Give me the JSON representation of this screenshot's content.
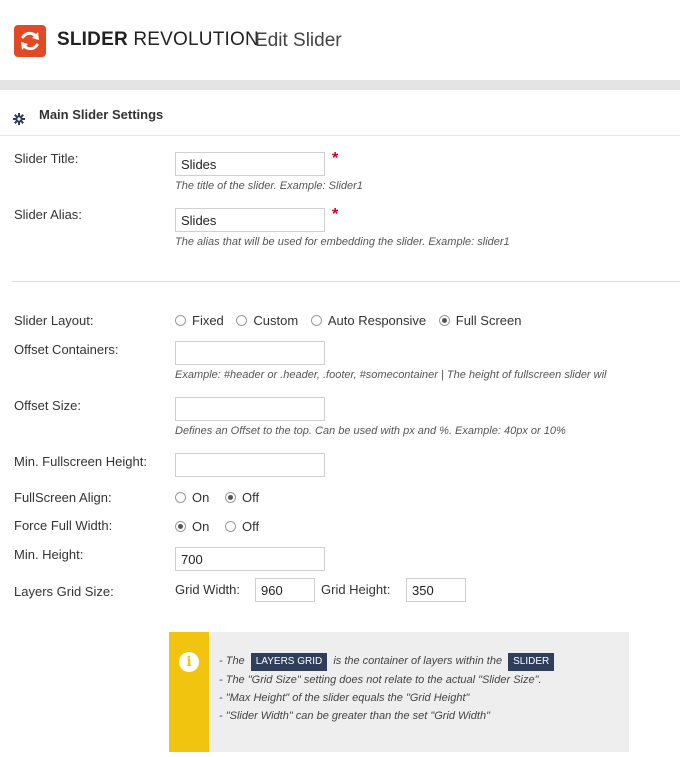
{
  "header": {
    "brand_bold": "SLIDER",
    "brand_light": "REVOLUTION",
    "page_title": "Edit Slider",
    "logo_color": "#e14a24"
  },
  "section": {
    "title": "Main Slider Settings",
    "icon": "gear-icon"
  },
  "fields": {
    "slider_title": {
      "label": "Slider Title:",
      "value": "Slides",
      "required": "*",
      "desc": "The title of the slider. Example: Slider1"
    },
    "slider_alias": {
      "label": "Slider Alias:",
      "value": "Slides",
      "required": "*",
      "desc": "The alias that will be used for embedding the slider. Example: slider1"
    },
    "slider_layout": {
      "label": "Slider Layout:",
      "options": [
        "Fixed",
        "Custom",
        "Auto Responsive",
        "Full Screen"
      ],
      "selected": "Full Screen"
    },
    "offset_containers": {
      "label": "Offset Containers:",
      "value": "",
      "desc": "Example: #header or .header, .footer, #somecontainer | The height of fullscreen slider wil"
    },
    "offset_size": {
      "label": "Offset Size:",
      "value": "",
      "desc": "Defines an Offset to the top. Can be used with px and %. Example: 40px or 10%"
    },
    "min_fullscreen_height": {
      "label": "Min. Fullscreen Height:",
      "value": ""
    },
    "fullscreen_align": {
      "label": "FullScreen Align:",
      "options": [
        "On",
        "Off"
      ],
      "selected": "Off"
    },
    "force_full_width": {
      "label": "Force Full Width:",
      "options": [
        "On",
        "Off"
      ],
      "selected": "On"
    },
    "min_height": {
      "label": "Min. Height:",
      "value": "700"
    },
    "layers_grid_size": {
      "label": "Layers Grid Size:",
      "grid_width_label": "Grid Width:",
      "grid_width": "960",
      "grid_height_label": "Grid Height:",
      "grid_height": "350"
    }
  },
  "info": {
    "accent": "#f1c40f",
    "line1_pre": "- The",
    "badge1": "LAYERS GRID",
    "line1_mid": "is the container of layers within the",
    "badge2": "SLIDER",
    "line2": "- The \"Grid Size\" setting does not relate to the actual \"Slider Size\".",
    "line3": "- \"Max Height\" of the slider equals the \"Grid Height\"",
    "line4": "- \"Slider Width\" can be greater than the set \"Grid Width\""
  }
}
